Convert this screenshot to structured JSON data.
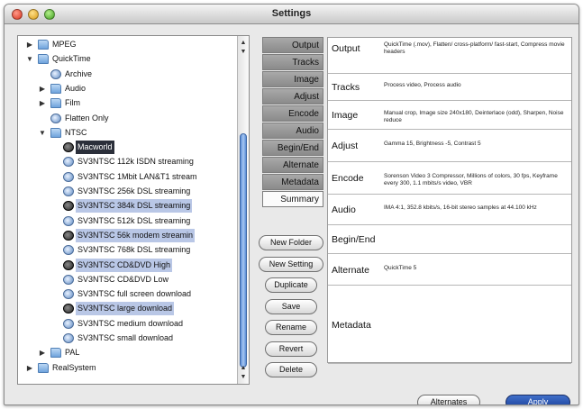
{
  "window": {
    "title": "Settings"
  },
  "tree": {
    "nodes": [
      {
        "label": "MPEG",
        "indent": 0,
        "disc": "▶",
        "icon": "folder",
        "state": ""
      },
      {
        "label": "QuickTime",
        "indent": 0,
        "disc": "▼",
        "icon": "folder",
        "state": ""
      },
      {
        "label": "Archive",
        "indent": 1,
        "disc": "",
        "icon": "setting",
        "state": ""
      },
      {
        "label": "Audio",
        "indent": 1,
        "disc": "▶",
        "icon": "folder",
        "state": ""
      },
      {
        "label": "Film",
        "indent": 1,
        "disc": "▶",
        "icon": "folder",
        "state": ""
      },
      {
        "label": "Flatten Only",
        "indent": 1,
        "disc": "",
        "icon": "setting",
        "state": ""
      },
      {
        "label": "NTSC",
        "indent": 1,
        "disc": "▼",
        "icon": "folder",
        "state": ""
      },
      {
        "label": "Macworld",
        "indent": 2,
        "disc": "",
        "icon": "setting-dark",
        "state": "dark"
      },
      {
        "label": "SV3NTSC 112k ISDN streaming",
        "indent": 2,
        "disc": "",
        "icon": "setting",
        "state": ""
      },
      {
        "label": "SV3NTSC 1Mbit LAN&T1 stream",
        "indent": 2,
        "disc": "",
        "icon": "setting",
        "state": ""
      },
      {
        "label": "SV3NTSC 256k DSL streaming",
        "indent": 2,
        "disc": "",
        "icon": "setting",
        "state": ""
      },
      {
        "label": "SV3NTSC 384k DSL streaming",
        "indent": 2,
        "disc": "",
        "icon": "setting-dark",
        "state": "sel"
      },
      {
        "label": "SV3NTSC 512k DSL streaming",
        "indent": 2,
        "disc": "",
        "icon": "setting",
        "state": ""
      },
      {
        "label": "SV3NTSC 56k modem streamin",
        "indent": 2,
        "disc": "",
        "icon": "setting-dark",
        "state": "sel"
      },
      {
        "label": "SV3NTSC 768k DSL streaming",
        "indent": 2,
        "disc": "",
        "icon": "setting",
        "state": ""
      },
      {
        "label": "SV3NTSC CD&DVD High",
        "indent": 2,
        "disc": "",
        "icon": "setting-dark",
        "state": "sel"
      },
      {
        "label": "SV3NTSC CD&DVD Low",
        "indent": 2,
        "disc": "",
        "icon": "setting",
        "state": ""
      },
      {
        "label": "SV3NTSC full screen download",
        "indent": 2,
        "disc": "",
        "icon": "setting",
        "state": ""
      },
      {
        "label": "SV3NTSC large download",
        "indent": 2,
        "disc": "",
        "icon": "setting-dark",
        "state": "sel"
      },
      {
        "label": "SV3NTSC medium download",
        "indent": 2,
        "disc": "",
        "icon": "setting",
        "state": ""
      },
      {
        "label": "SV3NTSC small download",
        "indent": 2,
        "disc": "",
        "icon": "setting",
        "state": ""
      },
      {
        "label": "PAL",
        "indent": 1,
        "disc": "▶",
        "icon": "folder",
        "state": ""
      },
      {
        "label": "RealSystem",
        "indent": 0,
        "disc": "▶",
        "icon": "folder",
        "state": ""
      }
    ]
  },
  "tabs": [
    "Output",
    "Tracks",
    "Image",
    "Adjust",
    "Encode",
    "Audio",
    "Begin/End",
    "Alternate",
    "Metadata",
    "Summary"
  ],
  "active_tab": "Summary",
  "buttons": {
    "new_folder": "New Folder",
    "new_setting": "New Setting",
    "duplicate": "Duplicate",
    "save": "Save",
    "rename": "Rename",
    "revert": "Revert",
    "delete": "Delete",
    "alternates": "Alternates",
    "apply": "Apply"
  },
  "summary": [
    {
      "key": "Output",
      "value": "QuickTime (.mov), Flatten/ cross-platform/ fast-start, Compress movie headers"
    },
    {
      "key": "Tracks",
      "value": "Process video, Process audio"
    },
    {
      "key": "Image",
      "value": "Manual crop, Image size 240x180, Deinterlace (odd), Sharpen, Noise reduce"
    },
    {
      "key": "Adjust",
      "value": "Gamma 15, Brightness -5, Contrast 5"
    },
    {
      "key": "Encode",
      "value": "Sorenson Video 3 Compressor, Millions of colors, 30 fps, Keyframe every 300, 1.1 mbits/s video, VBR"
    },
    {
      "key": "Audio",
      "value": "IMA 4:1, 352.8 kbits/s, 16-bit stereo samples at 44.100 kHz"
    },
    {
      "key": "Begin/End",
      "value": ""
    },
    {
      "key": "Alternate",
      "value": "QuickTime 5"
    },
    {
      "key": "Metadata",
      "value": ""
    }
  ]
}
